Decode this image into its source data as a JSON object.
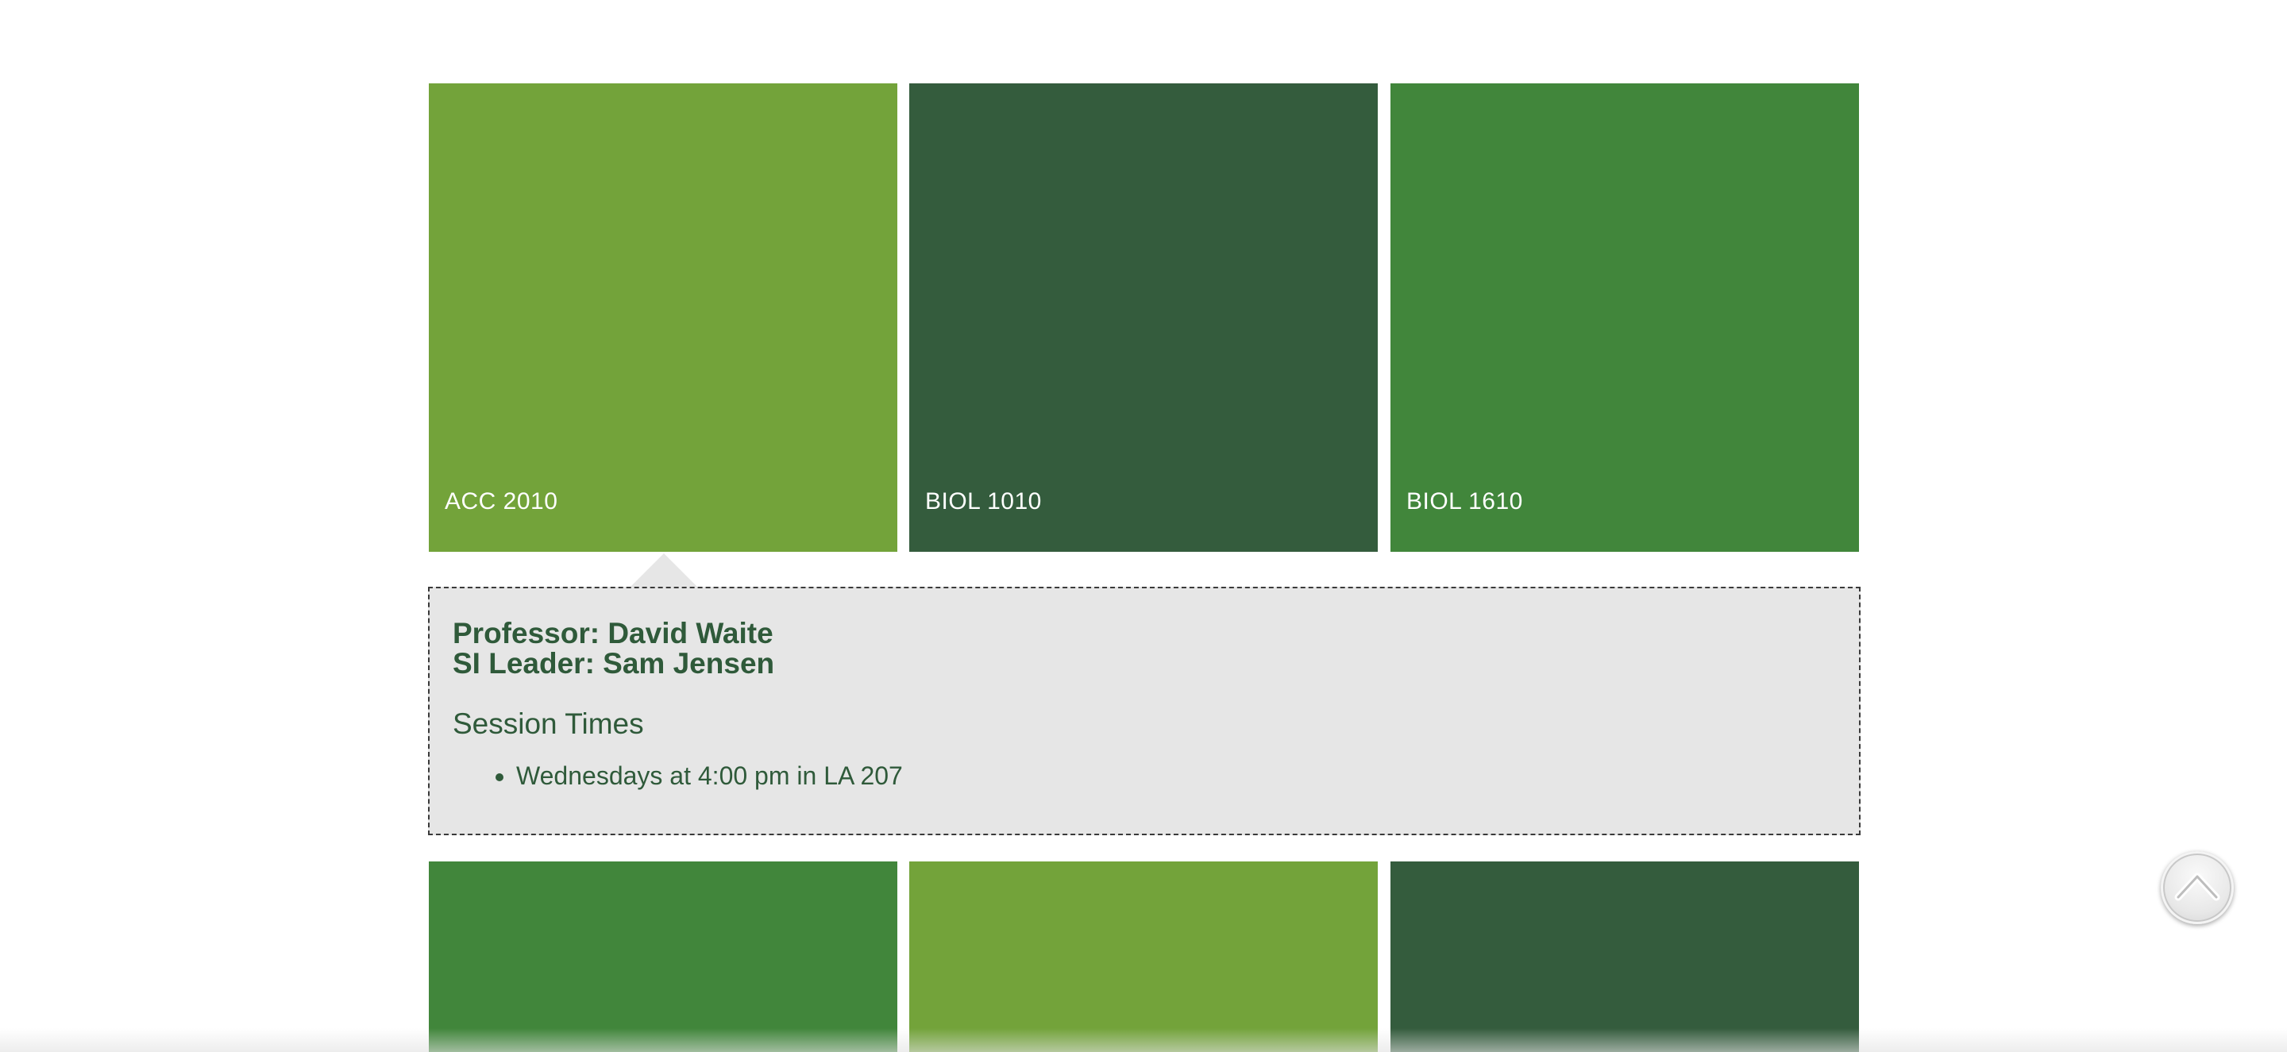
{
  "colors": {
    "light_green": "#73a33a",
    "dark_green": "#345c3d",
    "medium_green": "#41863b",
    "panel_bg": "#e6e6e6",
    "panel_text": "#2f5a3a"
  },
  "courses_row1": [
    {
      "label": "ACC 2010",
      "color": "#73a33a"
    },
    {
      "label": "BIOL 1010",
      "color": "#345c3d"
    },
    {
      "label": "BIOL 1610",
      "color": "#41863b"
    }
  ],
  "detail": {
    "professor": "Professor: David Waite",
    "si_leader": "SI Leader: Sam Jensen",
    "session_heading": "Session Times",
    "sessions": [
      "Wednesdays at 4:00 pm in LA 207"
    ]
  },
  "courses_row2": [
    {
      "color": "#41863b"
    },
    {
      "color": "#73a33a"
    },
    {
      "color": "#345c3d"
    }
  ],
  "scroll_top": {
    "icon": "chevron-up-icon"
  }
}
